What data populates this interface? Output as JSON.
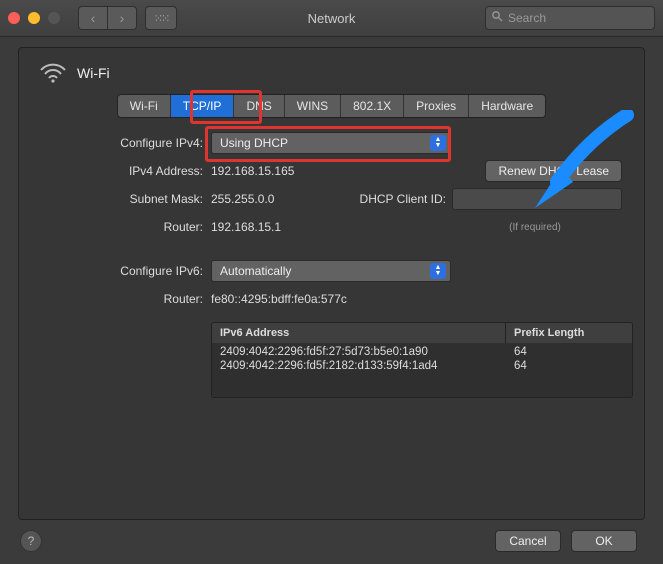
{
  "window": {
    "title": "Network",
    "search_placeholder": "Search"
  },
  "section": {
    "title": "Wi-Fi"
  },
  "tabs": {
    "wifi": "Wi-Fi",
    "tcpip": "TCP/IP",
    "dns": "DNS",
    "wins": "WINS",
    "dot1x": "802.1X",
    "proxies": "Proxies",
    "hardware": "Hardware"
  },
  "ipv4": {
    "configure_label": "Configure IPv4:",
    "configure_value": "Using DHCP",
    "address_label": "IPv4 Address:",
    "address_value": "192.168.15.165",
    "subnet_label": "Subnet Mask:",
    "subnet_value": "255.255.0.0",
    "router_label": "Router:",
    "router_value": "192.168.15.1",
    "renew_button": "Renew DHCP Lease",
    "client_id_label": "DHCP Client ID:",
    "client_id_value": "",
    "client_id_note": "(If required)"
  },
  "ipv6": {
    "configure_label": "Configure IPv6:",
    "configure_value": "Automatically",
    "router_label": "Router:",
    "router_value": "fe80::4295:bdff:fe0a:577c",
    "table_headers": {
      "address": "IPv6 Address",
      "prefix": "Prefix Length"
    },
    "rows": [
      {
        "address": "2409:4042:2296:fd5f:27:5d73:b5e0:1a90",
        "prefix": "64"
      },
      {
        "address": "2409:4042:2296:fd5f:2182:d133:59f4:1ad4",
        "prefix": "64"
      }
    ]
  },
  "footer": {
    "cancel": "Cancel",
    "ok": "OK",
    "help": "?"
  }
}
